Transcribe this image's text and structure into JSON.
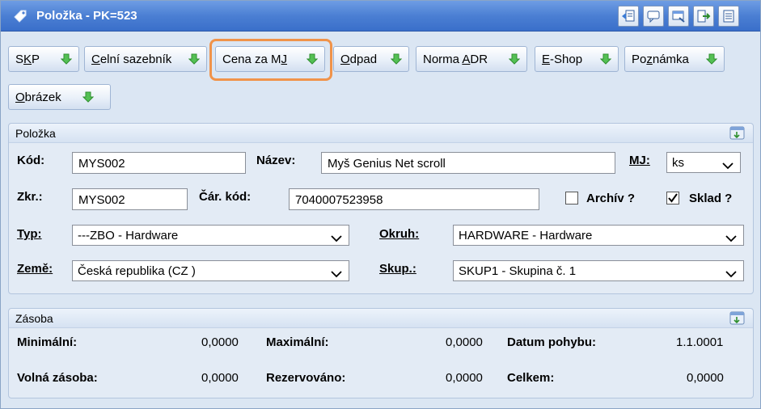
{
  "window": {
    "title": "Položka - PK=523",
    "title_icon": "tag-icon",
    "title_buttons": [
      "back-document-icon",
      "comment-icon",
      "window-icon",
      "export-arrow-icon",
      "list-icon"
    ]
  },
  "tabs": [
    {
      "label": "SKP",
      "underline": "K"
    },
    {
      "label": "Celní sazebník",
      "underline": "C"
    },
    {
      "label": "Cena za MJ",
      "underline": "J"
    },
    {
      "label": "Odpad",
      "underline": "O"
    },
    {
      "label": "Norma ADR",
      "underline": "A"
    },
    {
      "label": "E-Shop",
      "underline": "E"
    },
    {
      "label": "Poznámka",
      "underline": "z"
    },
    {
      "label": "Obrázek",
      "underline": "O"
    }
  ],
  "polozka": {
    "header": "Položka",
    "kod_label": "Kód:",
    "kod_value": "MYS002",
    "nazev_label": "Název:",
    "nazev_value": "Myš Genius Net scroll",
    "mj_label": "MJ:",
    "mj_value": "ks",
    "zkr_label": "Zkr.:",
    "zkr_value": "MYS002",
    "car_kod_label": "Čár. kód:",
    "car_kod_value": "7040007523958",
    "archiv_label": "Archív ?",
    "archiv_checked": false,
    "sklad_label": "Sklad ?",
    "sklad_checked": true,
    "typ_label": "Typ:",
    "typ_value": "---ZBO - Hardware",
    "okruh_label": "Okruh:",
    "okruh_value": "HARDWARE - Hardware",
    "zeme_label": "Země:",
    "zeme_value": "Česká republika (CZ )",
    "skup_label": "Skup.:",
    "skup_value": "SKUP1 - Skupina č. 1"
  },
  "zasoba": {
    "header": "Zásoba",
    "minimalni_label": "Minimální:",
    "minimalni_value": "0,0000",
    "maximalni_label": "Maximální:",
    "maximalni_value": "0,0000",
    "datum_label": "Datum pohybu:",
    "datum_value": "1.1.0001",
    "volna_label": "Volná zásoba:",
    "volna_value": "0,0000",
    "rezervovano_label": "Rezervováno:",
    "rezervovano_value": "0,0000",
    "celkem_label": "Celkem:",
    "celkem_value": "0,0000"
  },
  "colors": {
    "title_bar": "#4b7fd3",
    "highlight": "#f0934a",
    "tab_arrow": "#3aa63a"
  }
}
